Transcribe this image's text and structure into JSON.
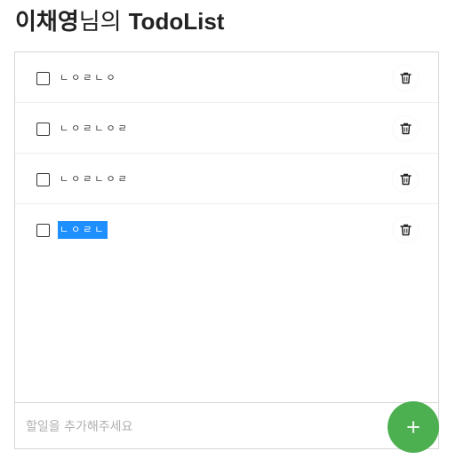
{
  "header": {
    "user_name": "이채영",
    "suffix": "님의",
    "app_name": "TodoList"
  },
  "todos": [
    {
      "text": "ㄴㅇㄹㄴㅇ",
      "checked": false,
      "selected": false
    },
    {
      "text": "ㄴㅇㄹㄴㅇㄹ",
      "checked": false,
      "selected": false
    },
    {
      "text": "ㄴㅇㄹㄴㅇㄹ",
      "checked": false,
      "selected": false
    },
    {
      "text": "ㄴㅇㄹㄴ",
      "checked": false,
      "selected": true
    }
  ],
  "input": {
    "placeholder": "할일을 추가해주세요",
    "value": ""
  },
  "icons": {
    "delete": "trash-icon",
    "add": "plus-icon"
  },
  "colors": {
    "add_button": "#4caf50",
    "selection": "#1e8fff"
  }
}
